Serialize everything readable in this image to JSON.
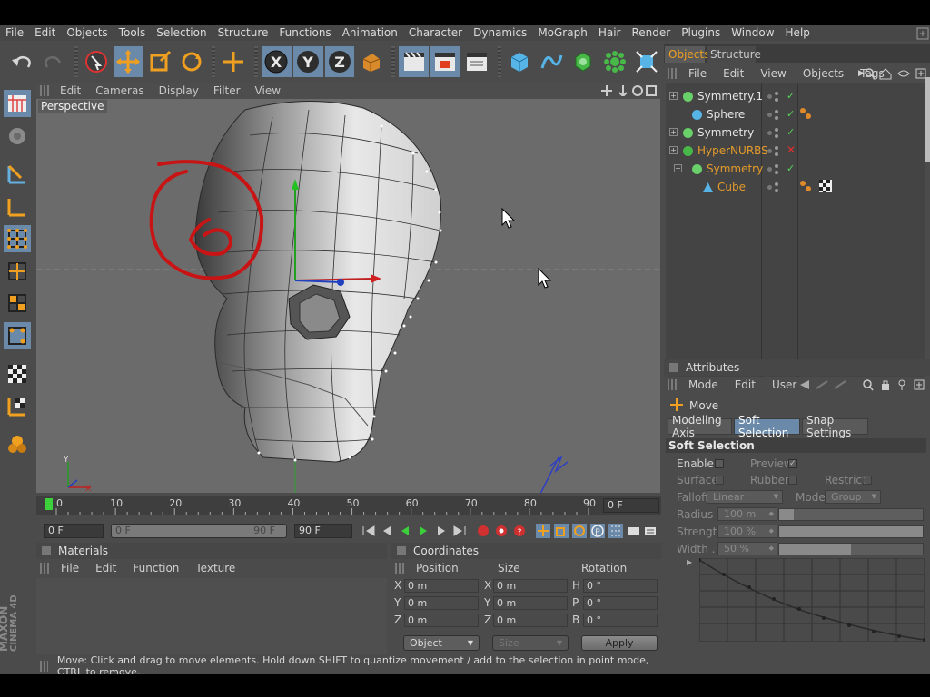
{
  "menubar": [
    "File",
    "Edit",
    "Objects",
    "Tools",
    "Selection",
    "Structure",
    "Functions",
    "Animation",
    "Character",
    "Dynamics",
    "MoGraph",
    "Hair",
    "Render",
    "Plugins",
    "Window",
    "Help"
  ],
  "viewport": {
    "menu": [
      "Edit",
      "Cameras",
      "Display",
      "Filter",
      "View"
    ],
    "label": "Perspective"
  },
  "timeline": {
    "ticks": [
      "0",
      "10",
      "20",
      "30",
      "40",
      "50",
      "60",
      "70",
      "80",
      "90"
    ],
    "current_frame": "0 F",
    "start_field": "0 F",
    "range_start": "0 F",
    "range_end": "90 F",
    "end_field": "90 F"
  },
  "materials": {
    "title": "Materials",
    "menu": [
      "File",
      "Edit",
      "Function",
      "Texture"
    ]
  },
  "coordinates": {
    "title": "Coordinates",
    "headers": [
      "Position",
      "Size",
      "Rotation"
    ],
    "rows": [
      {
        "axis": "X",
        "pos": "0 m",
        "size_axis": "X",
        "size": "0 m",
        "rot_axis": "H",
        "rot": "0 °"
      },
      {
        "axis": "Y",
        "pos": "0 m",
        "size_axis": "Y",
        "size": "0 m",
        "rot_axis": "P",
        "rot": "0 °"
      },
      {
        "axis": "Z",
        "pos": "0 m",
        "size_axis": "Z",
        "size": "0 m",
        "rot_axis": "B",
        "rot": "0 °"
      }
    ],
    "mode": "Object",
    "size_mode": "Size",
    "apply": "Apply"
  },
  "status": "Move: Click and drag to move elements. Hold down SHIFT to quantize movement / add to the selection in point mode, CTRL to remove.",
  "objects_panel": {
    "tabs": [
      "Objects",
      "Structure"
    ],
    "menu": [
      "File",
      "Edit",
      "View",
      "Objects",
      "Tags"
    ],
    "items": [
      {
        "name": "Symmetry.1",
        "color": "#e6e6e6",
        "state": "check"
      },
      {
        "name": "Sphere",
        "color": "#e6e6e6",
        "state": "check"
      },
      {
        "name": "Symmetry",
        "color": "#e6e6e6",
        "state": "check"
      },
      {
        "name": "HyperNURBS",
        "color": "#e39a2b",
        "state": "x"
      },
      {
        "name": "Symmetry",
        "color": "#e39a2b",
        "state": "check"
      },
      {
        "name": "Cube",
        "color": "#e39a2b",
        "state": "none"
      }
    ]
  },
  "attributes": {
    "title": "Attributes",
    "menu": [
      "Mode",
      "Edit",
      "User"
    ],
    "tool_name": "Move",
    "tabs": [
      "Modeling Axis",
      "Soft Selection",
      "Snap Settings"
    ],
    "section": "Soft Selection",
    "enable": "Enable",
    "preview": "Preview",
    "surface": "Surface",
    "rubber": "Rubber",
    "restrict": "Restrict",
    "falloff": "Falloff",
    "falloff_value": "Linear",
    "mode": "Mode",
    "mode_value": "Group",
    "radius": "Radius",
    "radius_value": "100 m",
    "strength": "Strength",
    "strength_value": "100 %",
    "width": "Width . .",
    "width_value": "50 %",
    "width_fraction": 0.5
  },
  "brand": {
    "line1": "MAXON",
    "line2": "CINEMA 4D"
  },
  "colors": {
    "selected": "#6b89a8",
    "annotation": "#c81414",
    "accent_orange": "#e39a2b"
  }
}
